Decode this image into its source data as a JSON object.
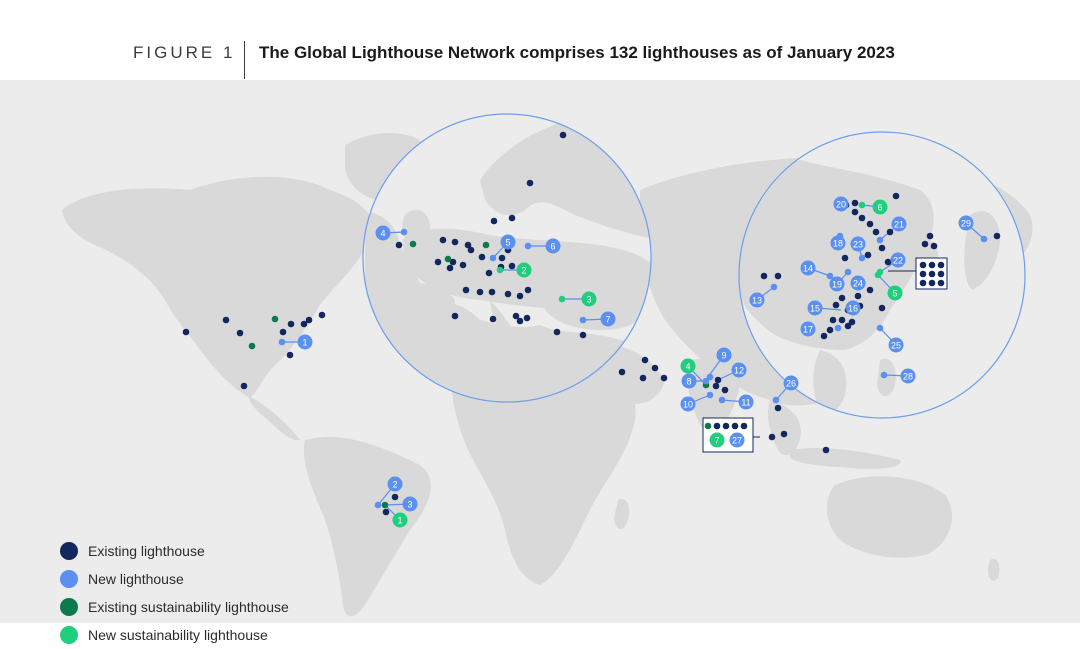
{
  "figure": {
    "label": "FIGURE 1",
    "title": "The Global Lighthouse Network comprises 132 lighthouses as of January 2023"
  },
  "colors": {
    "existing": "#13275f",
    "new": "#5b8ff0",
    "existing_sustainability": "#0c7a4b",
    "new_sustainability": "#1fcf7d",
    "land": "#d9d9d9",
    "ocean": "#ececec",
    "circle_stroke": "#6d9eec"
  },
  "legend": [
    {
      "label": "Existing lighthouse",
      "color": "#13275f"
    },
    {
      "label": "New lighthouse",
      "color": "#5b8ff0"
    },
    {
      "label": "Existing sustainability lighthouse",
      "color": "#0c7a4b"
    },
    {
      "label": "New sustainability lighthouse",
      "color": "#1fcf7d"
    }
  ],
  "callouts": {
    "new": [
      "1",
      "2",
      "3",
      "4",
      "5",
      "6",
      "7",
      "8",
      "9",
      "10",
      "11",
      "12",
      "13",
      "14",
      "15",
      "16",
      "17",
      "18",
      "19",
      "20",
      "21",
      "22",
      "23",
      "24",
      "25",
      "26",
      "27",
      "28",
      "29"
    ],
    "new_sustainability": [
      "1",
      "2",
      "3",
      "4",
      "5",
      "6",
      "7"
    ]
  }
}
